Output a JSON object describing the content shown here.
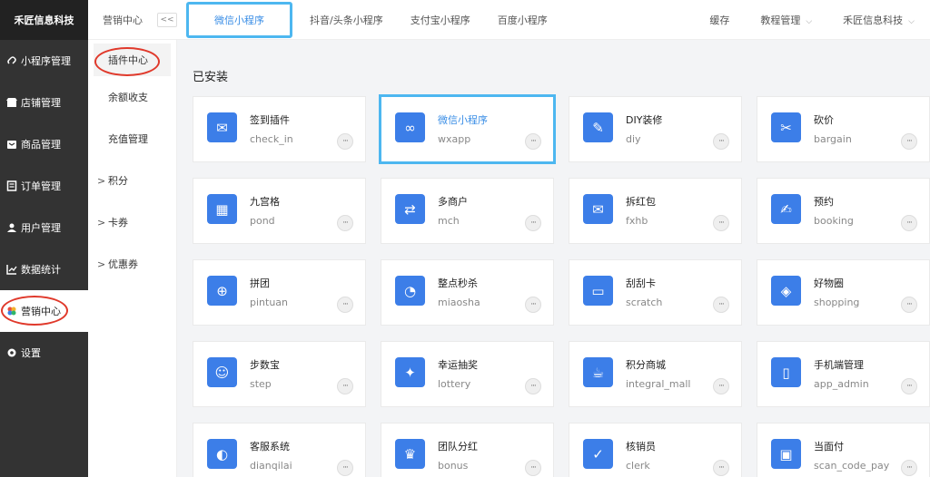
{
  "brand": "禾匠信息科技",
  "sidebar": {
    "items": [
      {
        "label": "小程序管理",
        "icon": "link-icon"
      },
      {
        "label": "店铺管理",
        "icon": "store-icon"
      },
      {
        "label": "商品管理",
        "icon": "goods-icon"
      },
      {
        "label": "订单管理",
        "icon": "order-icon"
      },
      {
        "label": "用户管理",
        "icon": "user-icon"
      },
      {
        "label": "数据统计",
        "icon": "chart-icon"
      },
      {
        "label": "营销中心",
        "icon": "marketing-icon"
      },
      {
        "label": "设置",
        "icon": "gear-icon"
      }
    ]
  },
  "subsidebar": {
    "items": [
      {
        "label": "插件中心"
      },
      {
        "label": "余额收支"
      },
      {
        "label": "充值管理"
      },
      {
        "label": "积分",
        "caret": ">"
      },
      {
        "label": "卡券",
        "caret": ">"
      },
      {
        "label": "优惠券",
        "caret": ">"
      }
    ]
  },
  "topbar": {
    "breadcrumb": "营销中心",
    "collapse": "<<",
    "tabs": [
      {
        "label": "微信小程序"
      },
      {
        "label": "抖音/头条小程序"
      },
      {
        "label": "支付宝小程序"
      },
      {
        "label": "百度小程序"
      }
    ],
    "right": {
      "cache": "缓存",
      "tutorial": "教程管理",
      "company": "禾匠信息科技"
    }
  },
  "main": {
    "section_title": "已安装",
    "plugins": [
      {
        "name": "签到插件",
        "code": "check_in",
        "glyph": "✉"
      },
      {
        "name": "微信小程序",
        "code": "wxapp",
        "glyph": "∞"
      },
      {
        "name": "DIY装修",
        "code": "diy",
        "glyph": "✎"
      },
      {
        "name": "砍价",
        "code": "bargain",
        "glyph": "✂"
      },
      {
        "name": "九宫格",
        "code": "pond",
        "glyph": "▦"
      },
      {
        "name": "多商户",
        "code": "mch",
        "glyph": "⇄"
      },
      {
        "name": "拆红包",
        "code": "fxhb",
        "glyph": "✉"
      },
      {
        "name": "预约",
        "code": "booking",
        "glyph": "✍"
      },
      {
        "name": "拼团",
        "code": "pintuan",
        "glyph": "⊕"
      },
      {
        "name": "整点秒杀",
        "code": "miaosha",
        "glyph": "◔"
      },
      {
        "name": "刮刮卡",
        "code": "scratch",
        "glyph": "▭"
      },
      {
        "name": "好物圈",
        "code": "shopping",
        "glyph": "◈"
      },
      {
        "name": "步数宝",
        "code": "step",
        "glyph": "☺"
      },
      {
        "name": "幸运抽奖",
        "code": "lottery",
        "glyph": "✦"
      },
      {
        "name": "积分商城",
        "code": "integral_mall",
        "glyph": "☕"
      },
      {
        "name": "手机端管理",
        "code": "app_admin",
        "glyph": "▯"
      },
      {
        "name": "客服系统",
        "code": "dianqilai",
        "glyph": "◐"
      },
      {
        "name": "团队分红",
        "code": "bonus",
        "glyph": "♛"
      },
      {
        "name": "核销员",
        "code": "clerk",
        "glyph": "✓"
      },
      {
        "name": "当面付",
        "code": "scan_code_pay",
        "glyph": "▣"
      }
    ],
    "more_glyph": "···"
  }
}
